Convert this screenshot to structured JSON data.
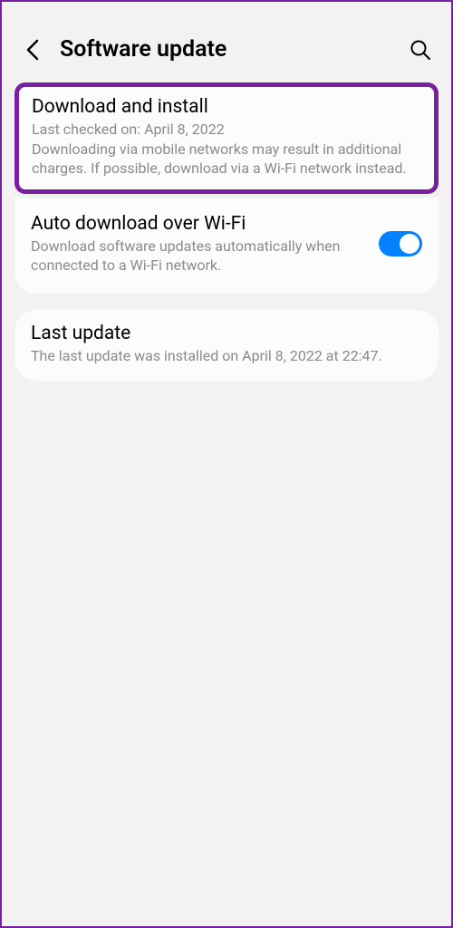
{
  "header": {
    "title": "Software update"
  },
  "download_install": {
    "title": "Download and install",
    "last_checked": "Last checked on: April 8, 2022",
    "description": "Downloading via mobile networks may result in additional charges. If possible, download via a Wi-Fi network instead."
  },
  "auto_download": {
    "title": "Auto download over Wi-Fi",
    "description": "Download software updates automatically when connected to a Wi-Fi network.",
    "enabled": true
  },
  "last_update": {
    "title": "Last update",
    "description": "The last update was installed on April 8, 2022 at 22:47."
  },
  "colors": {
    "highlight_border": "#7a1fa2",
    "toggle_on": "#0381fe"
  }
}
